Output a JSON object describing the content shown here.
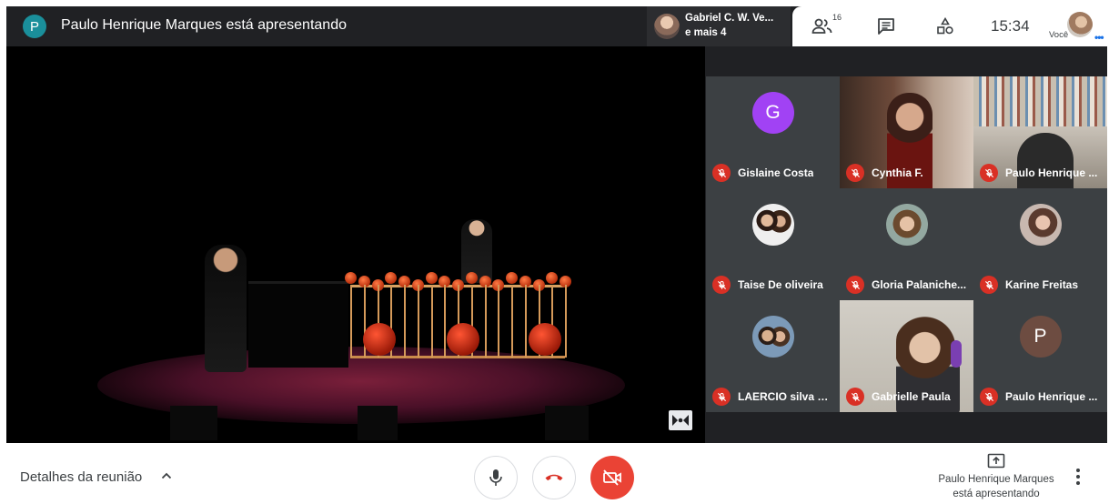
{
  "header": {
    "presenter_initial": "P",
    "presenter_title": "Paulo Henrique Marques está apresentando",
    "presenter_avatar_color": "#1a8f9b"
  },
  "active_speaker": {
    "name": "Gabriel C. W. Ve...",
    "more": "e mais 4"
  },
  "toolbar": {
    "people_count": "16",
    "people_icon": "people-icon",
    "chat_icon": "chat-icon",
    "activities_icon": "activities-icon",
    "time": "15:34",
    "you_label": "Você"
  },
  "participants": [
    {
      "name": "Gislaine Costa",
      "initial": "G",
      "avatar_color": "#a142f4",
      "kind": "initial"
    },
    {
      "name": "Cynthia F.",
      "kind": "video"
    },
    {
      "name": "Paulo Henrique ...",
      "kind": "video"
    },
    {
      "name": "Taise De oliveira",
      "kind": "photo"
    },
    {
      "name": "Gloria Palaniche...",
      "kind": "photo"
    },
    {
      "name": "Karine Freitas",
      "kind": "photo"
    },
    {
      "name": "LAERCIO silva e ...",
      "kind": "photo"
    },
    {
      "name": "Gabrielle Paula",
      "kind": "video"
    },
    {
      "name": "Paulo Henrique ...",
      "initial": "P",
      "avatar_color": "#6d4c41",
      "kind": "initial"
    }
  ],
  "footer": {
    "details_label": "Detalhes da reunião",
    "presenting_line1": "Paulo Henrique Marques",
    "presenting_line2": "está apresentando",
    "hangup_color": "#d93025",
    "camera_off_color": "#ea4335"
  }
}
